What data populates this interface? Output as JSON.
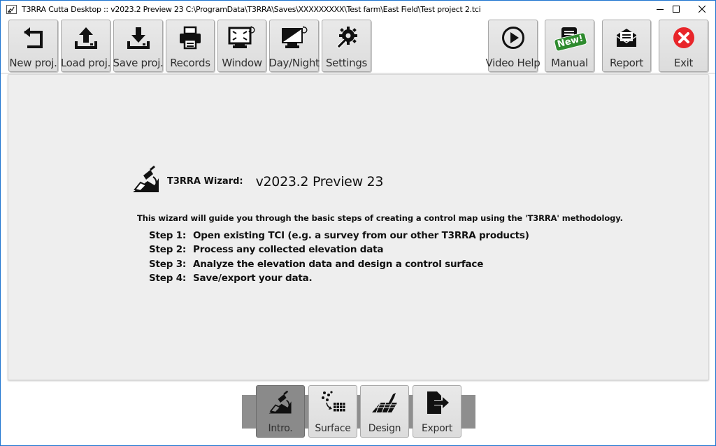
{
  "window": {
    "title": "T3RRA Cutta Desktop :: v2023.2 Preview 23 C:\\ProgramData\\T3RRA\\Saves\\XXXXXXXXX\\Test farm\\East Field\\Test project 2.tci"
  },
  "toolbar": {
    "new_proj": "New proj.",
    "load_proj": "Load proj.",
    "save_proj": "Save proj.",
    "records": "Records",
    "window": "Window",
    "day_night": "Day/Night",
    "settings": "Settings",
    "video_help": "Video Help",
    "manual": "Manual",
    "manual_badge": "New!",
    "report": "Report",
    "exit": "Exit"
  },
  "wizard": {
    "label": "T3RRA Wizard:",
    "version": "v2023.2 Preview 23",
    "intro": "This wizard will guide you through the basic steps of creating a control map using the 'T3RRA' methodology.",
    "steps": [
      {
        "num": "Step 1:",
        "text": "Open existing TCI (e.g. a survey from our other T3RRA products)"
      },
      {
        "num": "Step 2:",
        "text": "Process any collected elevation data"
      },
      {
        "num": "Step 3:",
        "text": "Analyze the elevation data and design a control surface"
      },
      {
        "num": "Step 4:",
        "text": "Save/export your data."
      }
    ]
  },
  "nav": {
    "intro": "Intro.",
    "surface": "Surface",
    "design": "Design",
    "export": "Export",
    "active": "intro"
  },
  "colors": {
    "exit_red": "#e8252a",
    "badge_green": "#2e8b2e",
    "titlebar_border": "#1e74d0"
  }
}
